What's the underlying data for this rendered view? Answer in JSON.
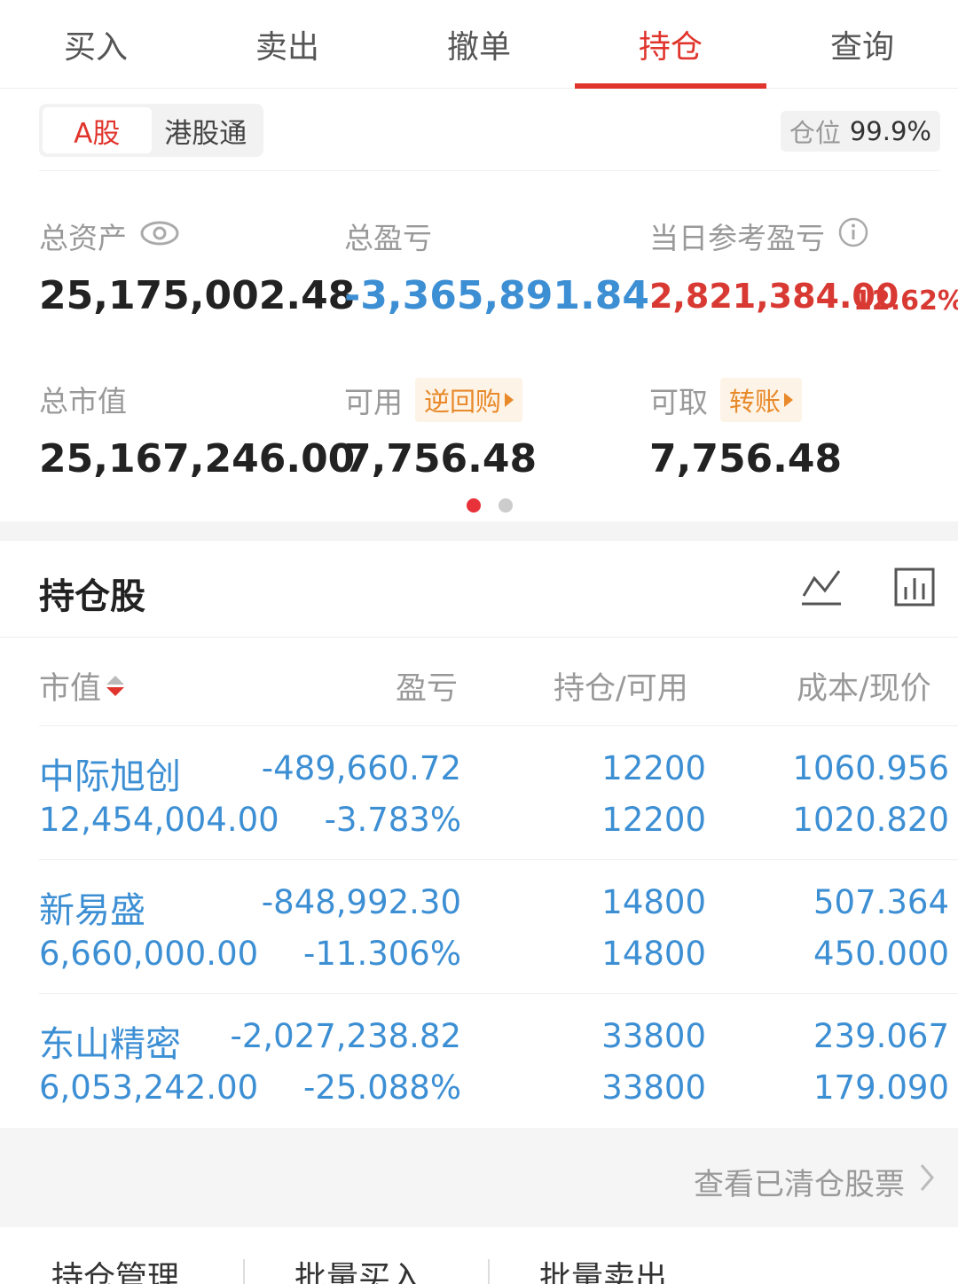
{
  "top_tabs": [
    "买入",
    "卖出",
    "撤单",
    "持仓",
    "查询"
  ],
  "active_tab": "持仓",
  "market_switch": {
    "options": [
      "A股",
      "港股通"
    ],
    "active": "A股"
  },
  "position": {
    "label": "仓位",
    "value": "99.9%"
  },
  "assets": {
    "total_assets": {
      "label": "总资产",
      "value": "25,175,002.48"
    },
    "total_pnl": {
      "label": "总盈亏",
      "value": "-3,365,891.84"
    },
    "daily_pnl": {
      "label": "当日参考盈亏",
      "value": "2,821,384.00",
      "percent": "12.62%"
    },
    "market_value": {
      "label": "总市值",
      "value": "25,167,246.00"
    },
    "available": {
      "label": "可用",
      "tag": "逆回购",
      "value": "7,756.48"
    },
    "withdrawable": {
      "label": "可取",
      "tag": "转账",
      "value": "7,756.48"
    }
  },
  "holdings": {
    "title": "持仓股",
    "columns": [
      "市值",
      "盈亏",
      "持仓/可用",
      "成本/现价"
    ],
    "rows": [
      {
        "name": "中际旭创",
        "market_value": "12,454,004.00",
        "pnl": "-489,660.72",
        "pnl_pct": "-3.783%",
        "holding": "12200",
        "available": "12200",
        "cost": "1060.956",
        "price": "1020.820"
      },
      {
        "name": "新易盛",
        "market_value": "6,660,000.00",
        "pnl": "-848,992.30",
        "pnl_pct": "-11.306%",
        "holding": "14800",
        "available": "14800",
        "cost": "507.364",
        "price": "450.000"
      },
      {
        "name": "东山精密",
        "market_value": "6,053,242.00",
        "pnl": "-2,027,238.82",
        "pnl_pct": "-25.088%",
        "holding": "33800",
        "available": "33800",
        "cost": "239.067",
        "price": "179.090"
      }
    ]
  },
  "cleared_link": "查看已清仓股票",
  "bottom_bar": [
    "持仓管理",
    "批量买入",
    "批量卖出"
  ],
  "colors": {
    "accent_red": "#e0342c",
    "value_blue": "#3d8fd4",
    "tag_orange": "#e8892a"
  }
}
